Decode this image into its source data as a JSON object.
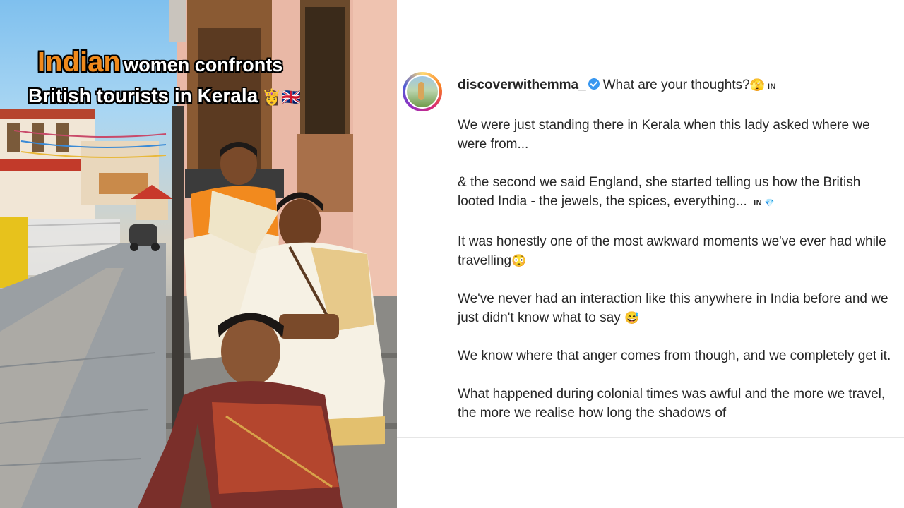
{
  "overlay": {
    "highlight": "Indian",
    "line1_rest": "women confronts",
    "line2": "British tourists in Kerala",
    "line2_emojis": "👸🇬🇧"
  },
  "post": {
    "username": "discoverwithemma_",
    "title": "What are your thoughts?",
    "title_emoji": "🫣",
    "flag_in": "IN",
    "paragraphs": [
      {
        "text": "We were just standing there in Kerala when this lady asked where we were from...",
        "suffix": ""
      },
      {
        "text": "& the second we said England, she started telling us how the British looted India - the jewels, the spices, everything...",
        "suffix": "IN 💎"
      },
      {
        "text": "It was honestly one of the most awkward moments we've ever had while travelling",
        "suffix": "😳"
      },
      {
        "text": "We've never had an interaction like this anywhere in India before and we just didn't know what to say",
        "suffix": "😅"
      },
      {
        "text": "We know where that anger comes from though, and we completely get it.",
        "suffix": ""
      },
      {
        "text": "What happened during colonial times was awful and the more we travel, the more we realise how long the shadows of",
        "suffix": ""
      }
    ]
  },
  "colors": {
    "overlay_highlight": "#f08a1c",
    "verified_badge": "#3897f0",
    "text": "#262626"
  },
  "icons": [
    "verified-badge-icon",
    "avatar"
  ]
}
